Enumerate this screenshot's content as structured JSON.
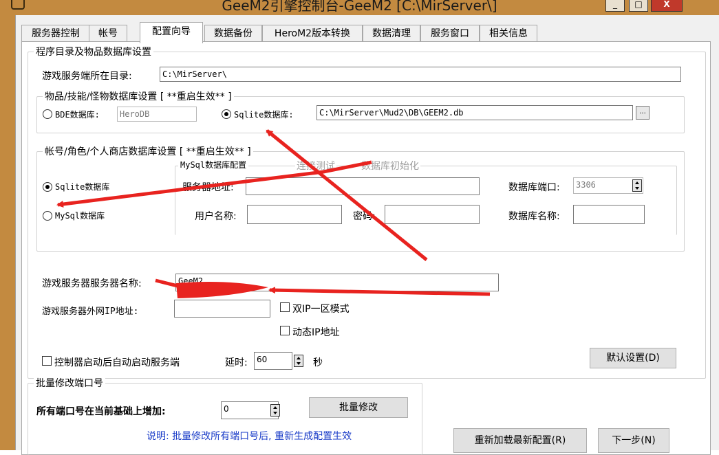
{
  "window": {
    "title": "GeeM2引擎控制台-GeeM2 [C:\\MirServer\\]",
    "minimize_label": "_",
    "maximize_label": "□",
    "close_label": "X"
  },
  "tabs": [
    "服务器控制",
    "帐号",
    "配置向导",
    "数据备份",
    "HeroM2版本转换",
    "数据清理",
    "服务窗口",
    "相关信息"
  ],
  "active_tab": "配置向导",
  "program_group": {
    "title": "程序目录及物品数据库设置",
    "server_dir_label": "游戏服务端所在目录:",
    "server_dir_value": "C:\\MirServer\\",
    "item_db": {
      "title": "物品/技能/怪物数据库设置 [ **重启生效** ]",
      "bde_label": "BDE数据库:",
      "bde_value": "HeroDB",
      "sqlite_label": "Sqlite数据库:",
      "sqlite_value": "C:\\MirServer\\Mud2\\DB\\GEEM2.db",
      "browse_label": "...",
      "selected": "sqlite"
    },
    "account_db": {
      "title": "帐号/角色/个人商店数据库设置 [ **重启生效** ]",
      "sqlite_label": "Sqlite数据库",
      "mysql_label": "MySql数据库",
      "selected": "sqlite",
      "mysql_config_title": "MySql数据库配置",
      "test_connection": "连接测试",
      "init_db": "数据库初始化",
      "server_addr_label": "服务器地址:",
      "server_addr_value": "",
      "db_port_label": "数据库端口:",
      "db_port_value": "3306",
      "username_label": "用户名称:",
      "username_value": "",
      "password_label": "密码:",
      "password_value": "",
      "db_name_label": "数据库名称:",
      "db_name_value": ""
    },
    "server_name_label": "游戏服务器服务器名称:",
    "server_name_value": "GeeM2",
    "external_ip_label": "游戏服务器外网IP地址:",
    "external_ip_value": "",
    "dual_ip_label": "双IP一区模式",
    "dynamic_ip_label": "动态IP地址",
    "autostart_label": "控制器启动后自动启动服务端",
    "delay_label": "延时:",
    "delay_value": "60",
    "delay_unit": "秒",
    "default_settings_button": "默认设置(D)"
  },
  "batch_ports": {
    "title": "批量修改端口号",
    "increase_label": "所有端口号在当前基础上增加:",
    "increase_value": "0",
    "batch_button": "批量修改",
    "note": "说明: 批量修改所有端口号后, 重新生成配置生效"
  },
  "footer": {
    "reload_button": "重新加载最新配置(R)",
    "next_button": "下一步(N)"
  },
  "colors": {
    "title_bar": "#c38a40",
    "annotation_arrow": "#e8231f",
    "note_text": "#1a3cc8"
  }
}
